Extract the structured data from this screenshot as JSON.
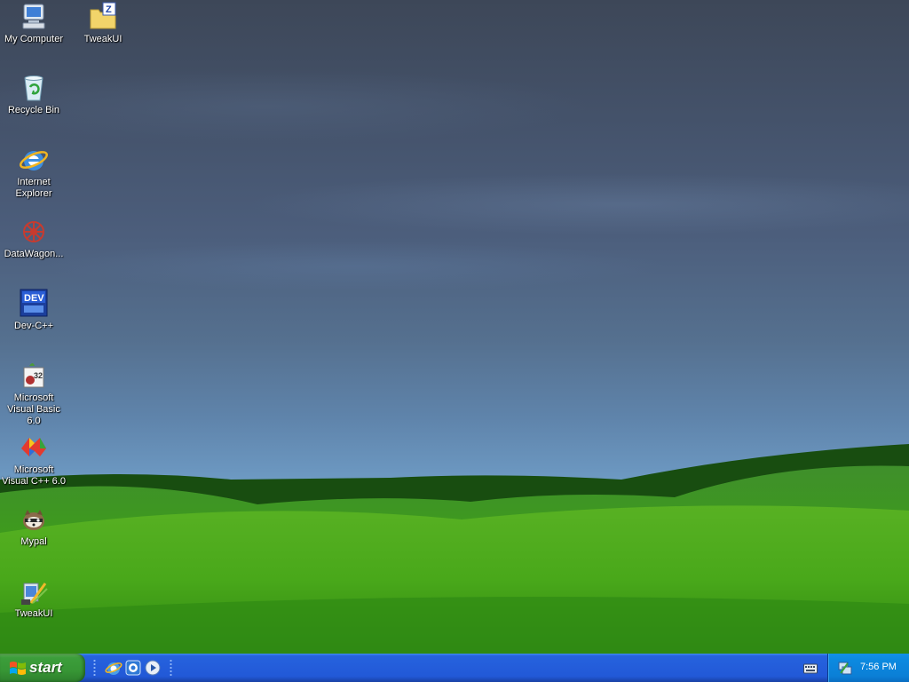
{
  "desktop": {
    "icons": [
      {
        "label": "My Computer",
        "icon": "computer-icon"
      },
      {
        "label": "TweakUI",
        "icon": "folder-icon"
      },
      {
        "label": "Recycle Bin",
        "icon": "recycle-bin-icon"
      },
      {
        "label": "Internet Explorer",
        "icon": "internet-explorer-icon"
      },
      {
        "label": "DataWagon...",
        "icon": "datawagon-icon"
      },
      {
        "label": "Dev-C++",
        "icon": "dev-cpp-icon"
      },
      {
        "label": "Microsoft Visual Basic 6.0",
        "icon": "visual-basic-icon"
      },
      {
        "label": "Microsoft Visual C++ 6.0",
        "icon": "visual-cpp-icon"
      },
      {
        "label": "Mypal",
        "icon": "mypal-icon"
      },
      {
        "label": "TweakUI",
        "icon": "tweakui-icon"
      }
    ]
  },
  "taskbar": {
    "start_label": "start",
    "quick_launch": [
      {
        "icon": "internet-explorer-icon"
      },
      {
        "icon": "ie-alt-icon"
      },
      {
        "icon": "media-player-icon"
      }
    ],
    "tray": {
      "clock": "7:56 PM",
      "icons": [
        "network-icon",
        "keyboard-icon"
      ]
    }
  },
  "colors": {
    "taskbar": "#245edb",
    "start_button": "#3c9e3b",
    "tray": "#0c8ae0"
  }
}
